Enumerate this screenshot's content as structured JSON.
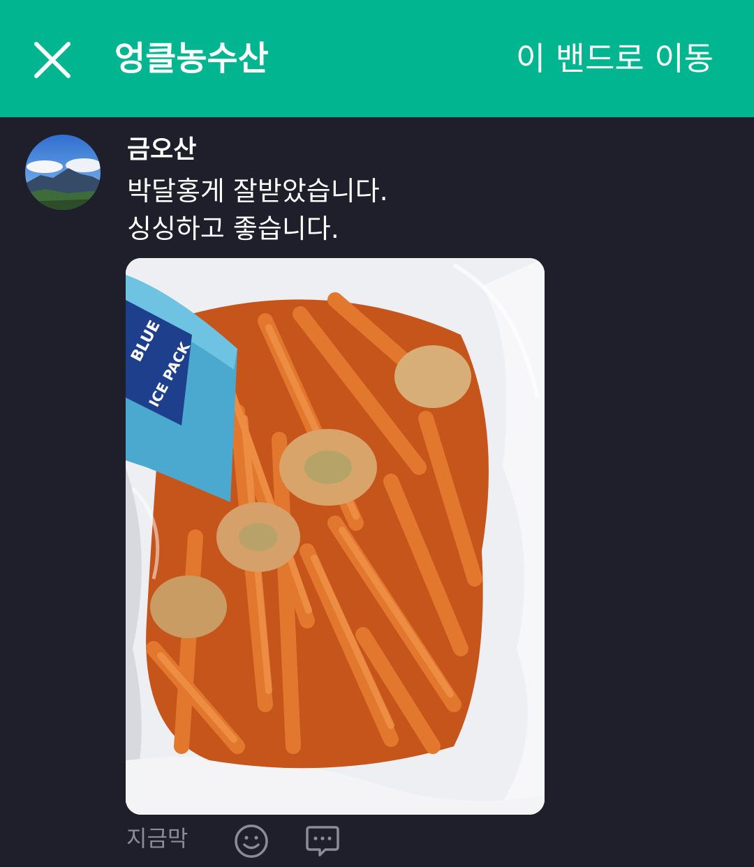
{
  "header": {
    "title": "엉클농수산",
    "action_label": "이 밴드로 이동",
    "background_color": "#00b58f"
  },
  "post": {
    "author": "금오산",
    "message_lines": [
      "박달홍게 잘받았습니다.",
      "싱싱하고 좋습니다."
    ],
    "photo_icon": "ice-pack-text: BLUE ICE PACK",
    "timestamp": "지금막"
  },
  "icons": {
    "close": "close-icon",
    "emoji": "smiley-icon",
    "comment": "comment-bubble-icon"
  },
  "colors": {
    "background": "#1e1f2b",
    "muted_text": "#8a8c96"
  }
}
